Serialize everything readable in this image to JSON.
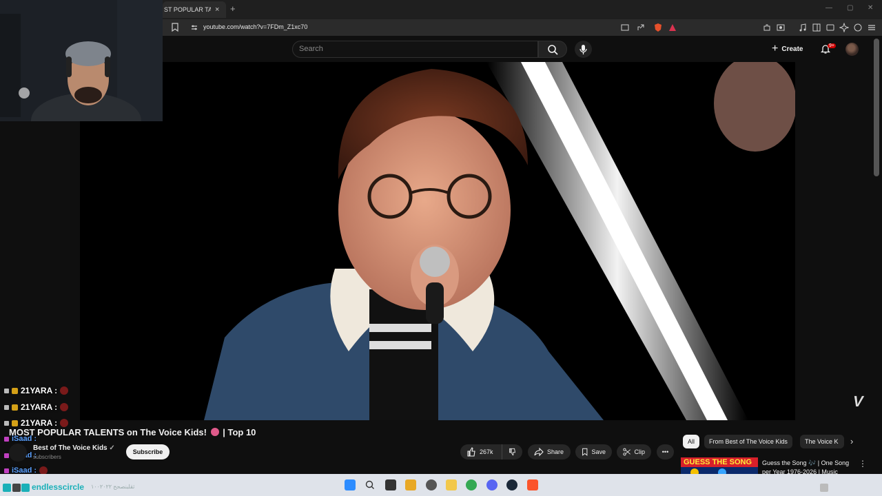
{
  "browser": {
    "tab_title": "ST POPULAR TALEN",
    "tab_close": "×",
    "new_tab": "+",
    "url": "youtube.com/watch?v=7FDm_Z1xc70"
  },
  "youtube": {
    "search_placeholder": "Search",
    "create_label": "Create",
    "notif_count": "9+"
  },
  "video": {
    "title_part1": "MOST POPULAR TALENTS on The Voice Kids!",
    "title_part2": "| Top 10",
    "channel_name": "Best of The Voice Kids",
    "subscribers": "subscribers",
    "subscribe_label": "Subscribe",
    "like_count": "267k",
    "share_label": "Share",
    "save_label": "Save",
    "clip_label": "Clip",
    "more_label": "•••",
    "logo_mark": "V"
  },
  "chips": {
    "all": "All",
    "from_channel": "From Best of The Voice Kids",
    "voice_kids": "The Voice K",
    "next": "›"
  },
  "recommendation": {
    "thumb_text": "GUESS THE SONG",
    "title": "Guess the Song 🎶 | One Song per Year 1976-2026 | Music",
    "menu": "⋮"
  },
  "chat": [
    {
      "user": "21YARA :",
      "type": "gold"
    },
    {
      "user": "21YARA :",
      "type": "gold"
    },
    {
      "user": "21YARA :",
      "type": "gold"
    },
    {
      "user": "iSaad :",
      "type": "blue"
    },
    {
      "user": "iSaad :",
      "type": "blue"
    },
    {
      "user": "iSaad :",
      "type": "blue"
    }
  ],
  "taskbar": {
    "stream_handle": "endlesscircle",
    "stream_sub": "ثقلبنصحح ١٠٠٢٠٢٢"
  },
  "colors": {
    "youtube_bg": "#0f0f0f",
    "accent_red": "#cc0000",
    "handle_teal": "#1ab0b8"
  }
}
